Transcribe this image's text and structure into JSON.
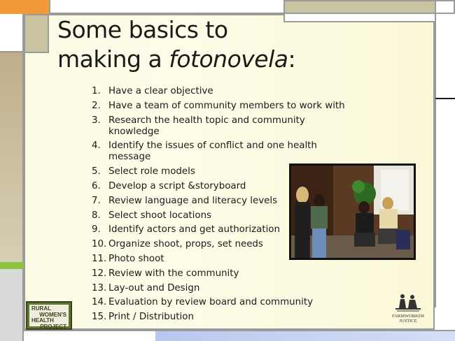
{
  "title": {
    "line1": "Some basics to",
    "line2_prefix": "making a ",
    "line2_italic": "fotonovela",
    "line2_suffix": ":"
  },
  "steps": [
    {
      "num": "1.",
      "text": "Have a clear objective"
    },
    {
      "num": "2.",
      "text": "Have a team of community members to work with"
    },
    {
      "num": "3.",
      "text": "Research the health topic and community knowledge"
    },
    {
      "num": "4.",
      "text": "Identify the issues of conflict and one health message"
    },
    {
      "num": "5.",
      "text": "Select role models"
    },
    {
      "num": "6.",
      "text": "Develop a script &storyboard"
    },
    {
      "num": "7.",
      "text": "Review language and literacy levels"
    },
    {
      "num": "8.",
      "text": "Select shoot locations"
    },
    {
      "num": "9.",
      "text": "Identify actors and get authorization"
    },
    {
      "num": "10.",
      "text": "Organize shoot, props, set needs"
    },
    {
      "num": "11.",
      "text": "Photo shoot"
    },
    {
      "num": "12.",
      "text": "Review with the community"
    },
    {
      "num": "13.",
      "text": "Lay-out and Design"
    },
    {
      "num": "14.",
      "text": "Evaluation by review board and community"
    },
    {
      "num": "15.",
      "text": "Print / Distribution"
    }
  ],
  "logos": {
    "rural": {
      "line1": "RURAL",
      "line2": "WOMEN'S",
      "line3": "HEALTH",
      "line4": "PROJECT"
    },
    "farmworker": {
      "line1": "FARMWORKER",
      "line2": "JUSTICE"
    }
  },
  "colors": {
    "panel_bg": "#fdfde8",
    "accent_orange": "#f29a3a",
    "accent_green": "#8cc63f",
    "accent_tan": "#c9c3a0",
    "accent_blue": "#b8c8ee"
  }
}
